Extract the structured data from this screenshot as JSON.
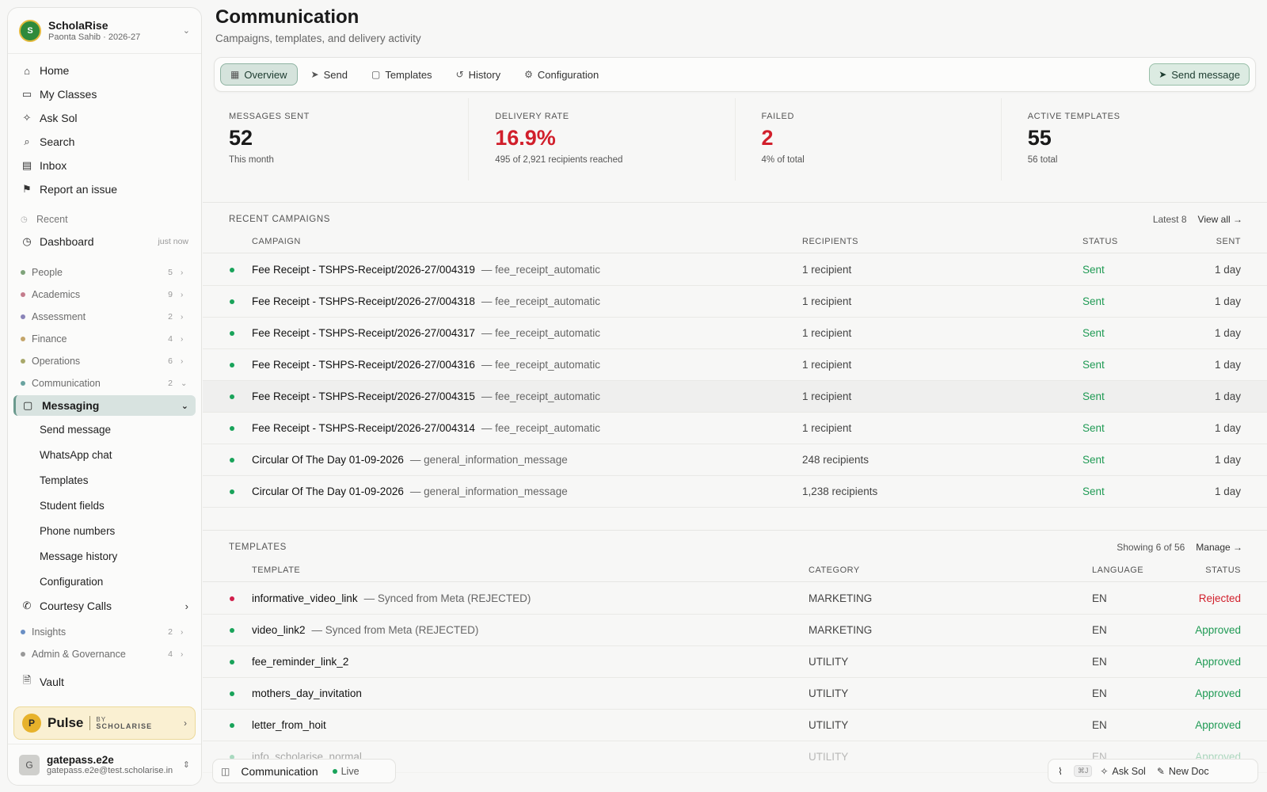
{
  "org": {
    "logo_text": "S",
    "name": "ScholaRise",
    "sub": "Paonta Sahib · 2026-27"
  },
  "nav_main": [
    {
      "label": "Home",
      "icon": "⌂"
    },
    {
      "label": "My Classes",
      "icon": "▭"
    },
    {
      "label": "Ask Sol",
      "icon": "✧"
    },
    {
      "label": "Search",
      "icon": "⌕"
    },
    {
      "label": "Inbox",
      "icon": "▤"
    },
    {
      "label": "Report an issue",
      "icon": "⚑"
    }
  ],
  "recent": {
    "label": "Recent",
    "item": "Dashboard",
    "item_meta": "just now"
  },
  "groups_top": [
    {
      "label": "People",
      "count": "5",
      "color": "#7fa37a"
    },
    {
      "label": "Academics",
      "count": "9",
      "color": "#c47c8c"
    },
    {
      "label": "Assessment",
      "count": "2",
      "color": "#8a84b8"
    },
    {
      "label": "Finance",
      "count": "4",
      "color": "#c4a56a"
    },
    {
      "label": "Operations",
      "count": "6",
      "color": "#a8a86a"
    },
    {
      "label": "Communication",
      "count": "2",
      "color": "#6aa3a0"
    }
  ],
  "messaging": {
    "label": "Messaging",
    "subitems": [
      "Send message",
      "WhatsApp chat",
      "Templates",
      "Student fields",
      "Phone numbers",
      "Message history",
      "Configuration"
    ]
  },
  "courtesy": "Courtesy Calls",
  "groups_bottom": [
    {
      "label": "Insights",
      "count": "2",
      "color": "#6a8fc4"
    },
    {
      "label": "Admin & Governance",
      "count": "4",
      "color": "#999999"
    }
  ],
  "vault": "Vault",
  "pulse": {
    "logo": "P",
    "name": "Pulse",
    "by": "BY",
    "brand": "SCHOLARISE"
  },
  "user": {
    "avatar": "G",
    "name": "gatepass.e2e",
    "email": "gatepass.e2e@test.scholarise.in"
  },
  "page": {
    "title": "Communication",
    "subtitle": "Campaigns, templates, and delivery activity"
  },
  "tabs": [
    "Overview",
    "Send",
    "Templates",
    "History",
    "Configuration"
  ],
  "send_button": "Send message",
  "stats": [
    {
      "label": "MESSAGES SENT",
      "value": "52",
      "note": "This month",
      "red": false
    },
    {
      "label": "DELIVERY RATE",
      "value": "16.9%",
      "note": "495 of 2,921 recipients reached",
      "red": true
    },
    {
      "label": "FAILED",
      "value": "2",
      "note": "4% of total",
      "red": true
    },
    {
      "label": "ACTIVE TEMPLATES",
      "value": "55",
      "note": "56 total",
      "red": false
    }
  ],
  "campaigns": {
    "title": "RECENT CAMPAIGNS",
    "latest": "Latest 8",
    "view_all": "View all →",
    "columns": [
      "CAMPAIGN",
      "RECIPIENTS",
      "STATUS",
      "SENT"
    ],
    "rows": [
      {
        "name": "Fee Receipt - TSHPS-Receipt/2026-27/004319",
        "desc": "— fee_receipt_automatic",
        "recipients": "1 recipient",
        "status": "Sent",
        "sent": "1 day"
      },
      {
        "name": "Fee Receipt - TSHPS-Receipt/2026-27/004318",
        "desc": "— fee_receipt_automatic",
        "recipients": "1 recipient",
        "status": "Sent",
        "sent": "1 day"
      },
      {
        "name": "Fee Receipt - TSHPS-Receipt/2026-27/004317",
        "desc": "— fee_receipt_automatic",
        "recipients": "1 recipient",
        "status": "Sent",
        "sent": "1 day"
      },
      {
        "name": "Fee Receipt - TSHPS-Receipt/2026-27/004316",
        "desc": "— fee_receipt_automatic",
        "recipients": "1 recipient",
        "status": "Sent",
        "sent": "1 day"
      },
      {
        "name": "Fee Receipt - TSHPS-Receipt/2026-27/004315",
        "desc": "— fee_receipt_automatic",
        "recipients": "1 recipient",
        "status": "Sent",
        "sent": "1 day"
      },
      {
        "name": "Fee Receipt - TSHPS-Receipt/2026-27/004314",
        "desc": "— fee_receipt_automatic",
        "recipients": "1 recipient",
        "status": "Sent",
        "sent": "1 day"
      },
      {
        "name": "Circular Of The Day 01-09-2026",
        "desc": "— general_information_message",
        "recipients": "248 recipients",
        "status": "Sent",
        "sent": "1 day"
      },
      {
        "name": "Circular Of The Day 01-09-2026",
        "desc": "— general_information_message",
        "recipients": "1,238 recipients",
        "status": "Sent",
        "sent": "1 day"
      }
    ]
  },
  "templates": {
    "title": "TEMPLATES",
    "showing": "Showing 6 of 56",
    "manage": "Manage →",
    "columns": [
      "TEMPLATE",
      "CATEGORY",
      "LANGUAGE",
      "STATUS"
    ],
    "rows": [
      {
        "name": "informative_video_link",
        "desc": "— Synced from Meta (REJECTED)",
        "category": "MARKETING",
        "language": "EN",
        "status": "Rejected"
      },
      {
        "name": "video_link2",
        "desc": "— Synced from Meta (REJECTED)",
        "category": "MARKETING",
        "language": "EN",
        "status": "Approved"
      },
      {
        "name": "fee_reminder_link_2",
        "desc": "",
        "category": "UTILITY",
        "language": "EN",
        "status": "Approved"
      },
      {
        "name": "mothers_day_invitation",
        "desc": "",
        "category": "UTILITY",
        "language": "EN",
        "status": "Approved"
      },
      {
        "name": "letter_from_hoit",
        "desc": "",
        "category": "UTILITY",
        "language": "EN",
        "status": "Approved"
      },
      {
        "name": "info_scholarise_normal",
        "desc": "",
        "category": "UTILITY",
        "language": "EN",
        "status": "Approved"
      }
    ]
  },
  "bottom_left": {
    "label": "Communication",
    "status": "Live"
  },
  "bottom_right": {
    "shortcut": "⌘J",
    "ask": "Ask Sol",
    "new_doc": "New Doc"
  }
}
